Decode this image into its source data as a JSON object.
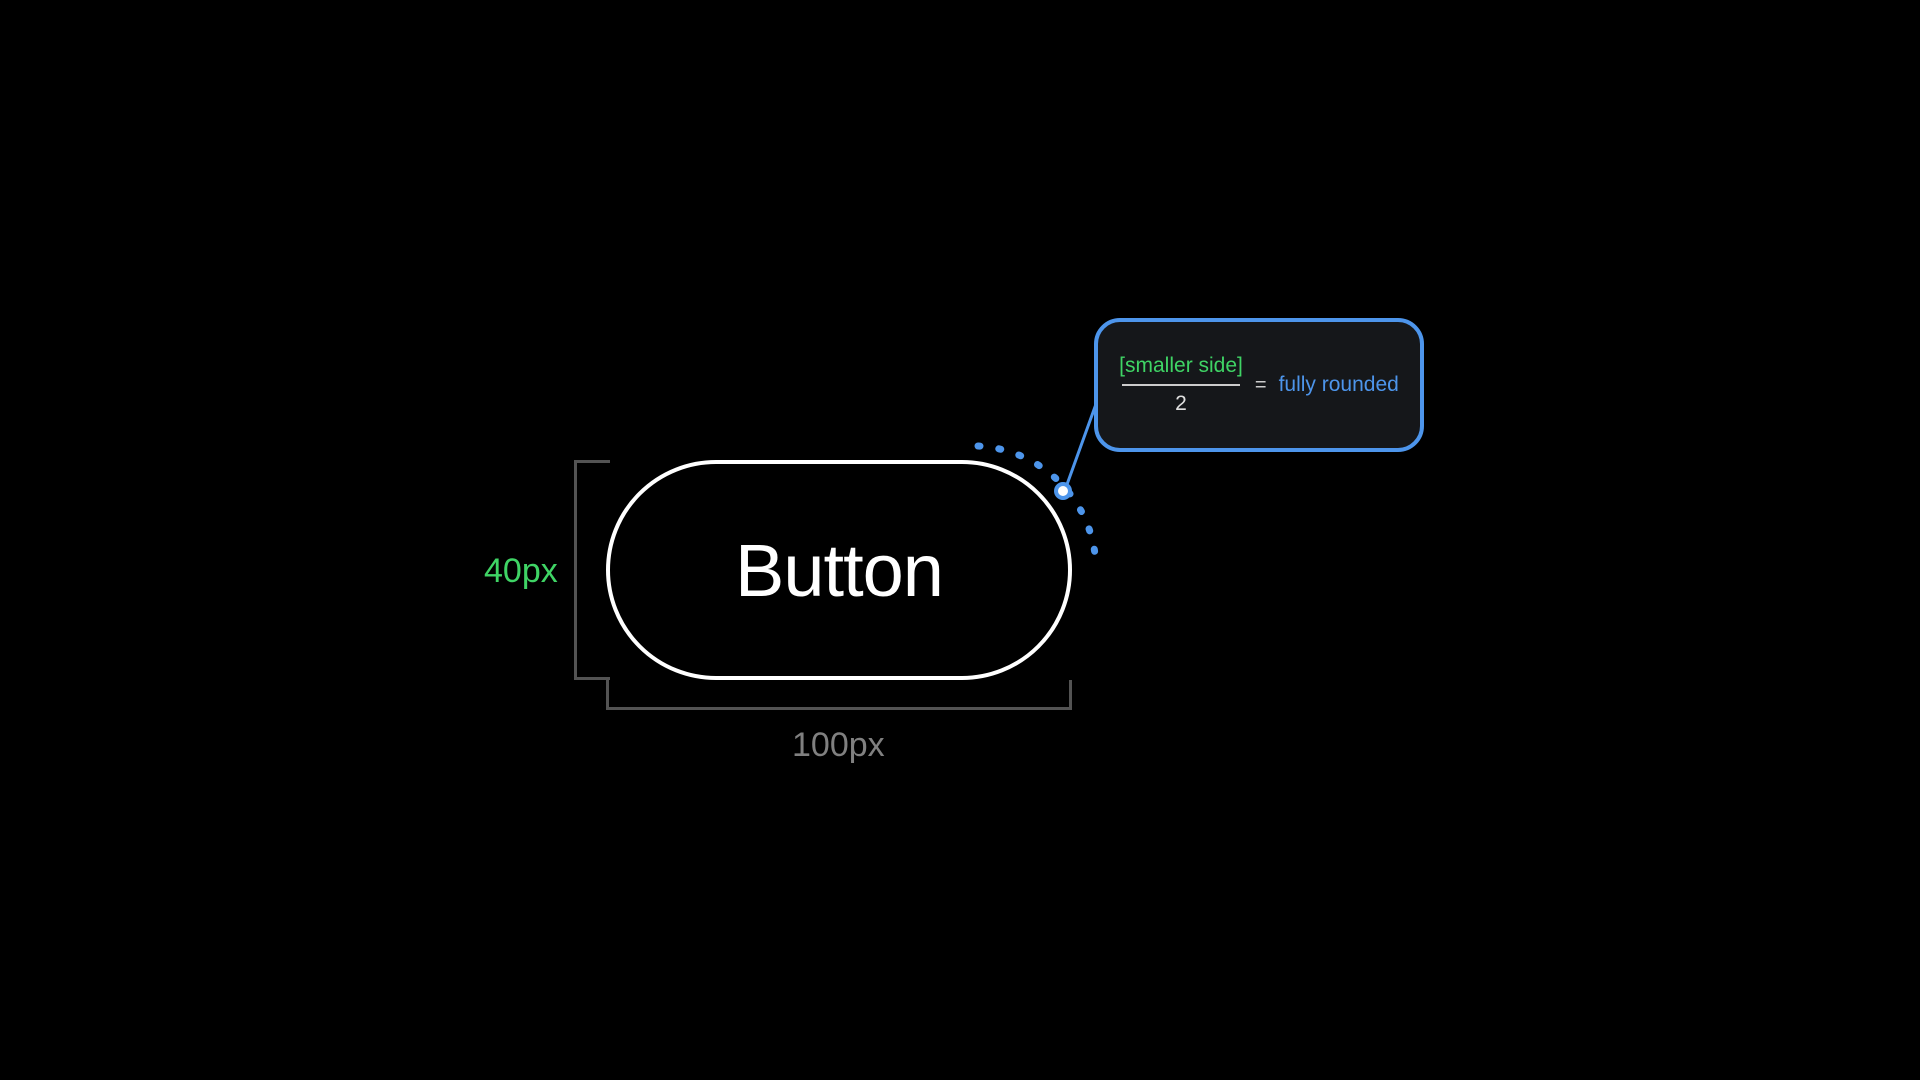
{
  "button": {
    "label": "Button",
    "width_label": "100px",
    "height_label": "40px"
  },
  "callout": {
    "numerator": "[smaller side]",
    "denominator": "2",
    "equals": "=",
    "result": "fully rounded"
  }
}
